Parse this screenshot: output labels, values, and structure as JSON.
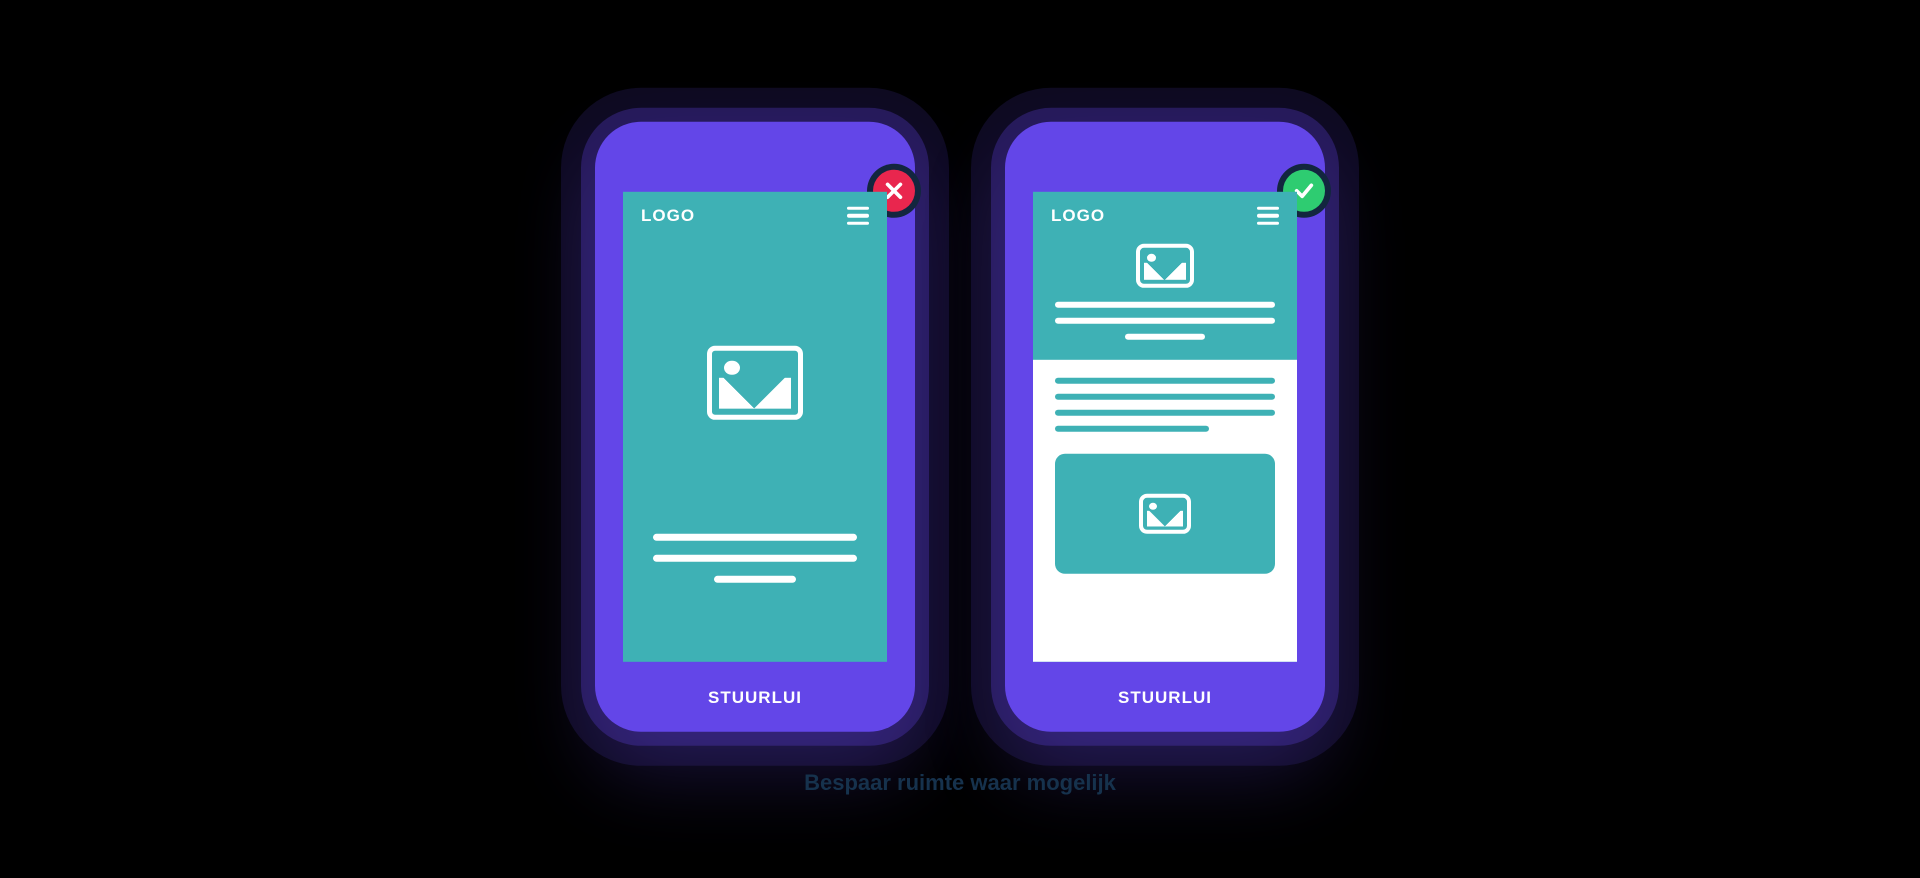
{
  "mockups": {
    "bad": {
      "logo": "LOGO",
      "footer": "STUURLUI",
      "badge": "cross"
    },
    "good": {
      "logo": "LOGO",
      "footer": "STUURLUI",
      "badge": "check"
    }
  },
  "caption": "Bespaar ruimte waar mogelijk",
  "colors": {
    "purple": "#6346e8",
    "teal": "#3eb1b5",
    "red": "#e9264e",
    "green": "#2ecc71",
    "navy": "#13263f"
  }
}
